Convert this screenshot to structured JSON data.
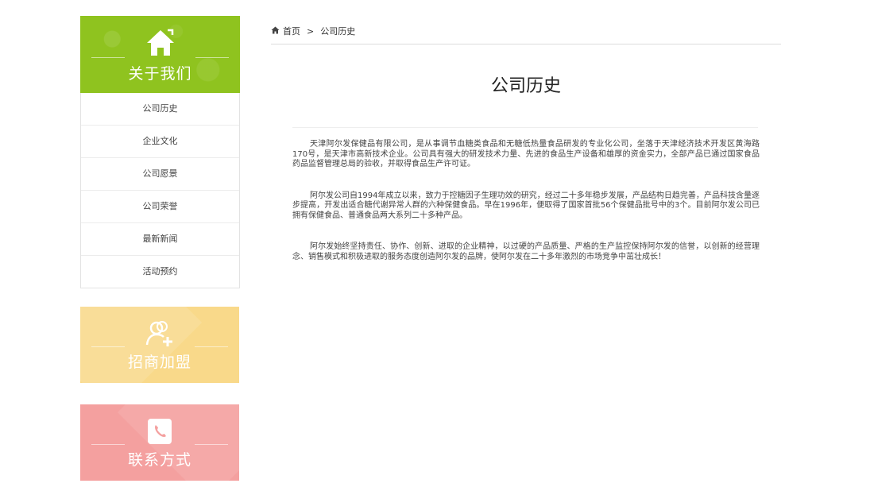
{
  "sidebar": {
    "about": {
      "title": "关于我们",
      "icon": "home-icon",
      "color": "#8fc31f",
      "items": [
        {
          "label": "公司历史"
        },
        {
          "label": "企业文化"
        },
        {
          "label": "公司愿景"
        },
        {
          "label": "公司荣誉"
        },
        {
          "label": "最新新闻"
        },
        {
          "label": "活动预约"
        }
      ]
    },
    "join": {
      "title": "招商加盟",
      "icon": "user-add-icon",
      "color": "#f9d98a"
    },
    "contact": {
      "title": "联系方式",
      "icon": "phone-book-icon",
      "color": "#f4a09f"
    }
  },
  "breadcrumb": {
    "home_icon": "home-icon",
    "home": "首页",
    "separator": ">",
    "current": "公司历史"
  },
  "main": {
    "title": "公司历史",
    "paragraphs": [
      "天津阿尔发保健品有限公司，是从事调节血糖类食品和无糖低热量食品研发的专业化公司，坐落于天津经济技术开发区黄海路170号，是天津市高新技术企业。公司具有强大的研发技术力量、先进的食品生产设备和雄厚的资金实力，全部产品已通过国家食品药品监督管理总局的验收，并取得食品生产许可证。",
      "阿尔发公司自1994年成立以来，致力于控糖因子生理功效的研究，经过二十多年稳步发展，产品结构日趋完善，产品科技含量逐步提高，开发出适合糖代谢异常人群的六种保健食品。早在1996年，便取得了国家首批56个保健品批号中的3个。目前阿尔发公司已拥有保健食品、普通食品两大系列二十多种产品。",
      "阿尔发始终坚持责任、协作、创新、进取的企业精神，以过硬的产品质量、严格的生产监控保持阿尔发的信誉，以创新的经营理念、销售模式和积极进取的服务态度创造阿尔发的品牌，使阿尔发在二十多年激烈的市场竞争中茁壮成长！"
    ]
  }
}
